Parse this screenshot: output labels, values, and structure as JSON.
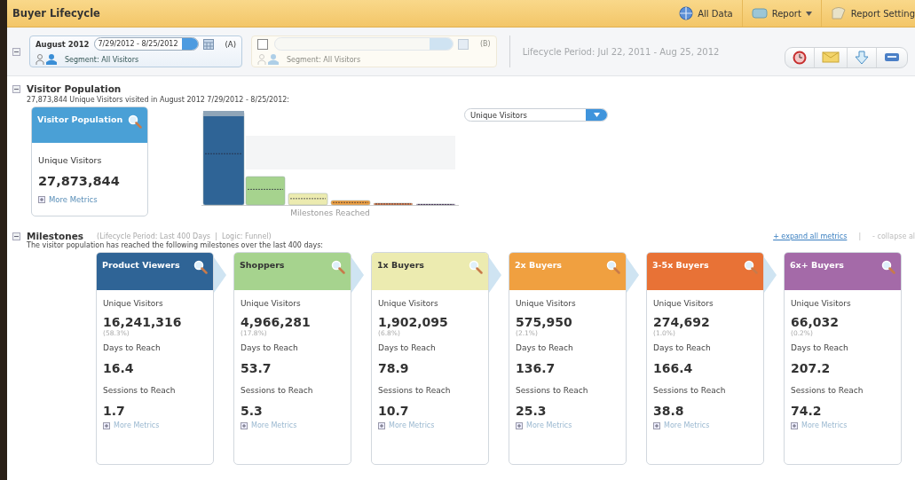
{
  "window": {
    "title": "Buyer Lifecycle"
  },
  "header_actions": [
    {
      "kind": "globe",
      "label": "All Data",
      "has_menu": false
    },
    {
      "kind": "report",
      "label": "Report",
      "has_menu": true
    },
    {
      "kind": "settings",
      "label": "Report Setting",
      "has_menu": false
    }
  ],
  "segment_a": {
    "period": "August 2012",
    "range": "7/29/2012 - 8/25/2012",
    "tag": "(A)",
    "segment": "Segment: All Visitors"
  },
  "segment_b": {
    "checked": false,
    "tag": "(B)",
    "segment": "Segment: All Visitors"
  },
  "lifecycle_period": "Lifecycle Period: Jul 22, 2011 - Aug 25, 2012",
  "action_buttons": [
    {
      "kind": "clock"
    },
    {
      "kind": "mail"
    },
    {
      "kind": "download"
    },
    {
      "kind": "print"
    }
  ],
  "visitor_population": {
    "title": "Visitor Population",
    "summary": "27,873,844 Unique Visitors visited in August 2012 7/29/2012 - 8/25/2012:",
    "card": {
      "title": "Visitor Population",
      "metric": "Unique Visitors",
      "value": "27,873,844",
      "more": "More Metrics"
    },
    "chart_label": "Milestones Reached",
    "dropdown": "Unique Visitors"
  },
  "milestones": {
    "title": "Milestones",
    "note": "(Lifecycle Period: Last 400 Days  |  Logic: Funnel)",
    "summary": "The visitor population has reached the following milestones over the last 400 days:",
    "expand": "+ expand all metrics",
    "separator": "|",
    "collapse": "- collapse al",
    "cards": [
      {
        "title": "Product Viewers",
        "color": "#2f6496",
        "uv_label": "Unique Visitors",
        "uv": "16,241,316",
        "share": "(58.3%)",
        "days_label": "Days to Reach",
        "days": "16.4",
        "sessions_label": "Sessions to Reach",
        "sessions": "1.7",
        "more": "More Metrics"
      },
      {
        "title": "Shoppers",
        "color": "#a6d38e",
        "uv_label": "Unique Visitors",
        "uv": "4,966,281",
        "share": "(17.8%)",
        "days_label": "Days to Reach",
        "days": "53.7",
        "sessions_label": "Sessions to Reach",
        "sessions": "5.3",
        "more": "More Metrics"
      },
      {
        "title": "1x Buyers",
        "color": "#ecebb0",
        "uv_label": "Unique Visitors",
        "uv": "1,902,095",
        "share": "(6.8%)",
        "days_label": "Days to Reach",
        "days": "78.9",
        "sessions_label": "Sessions to Reach",
        "sessions": "10.7",
        "more": "More Metrics"
      },
      {
        "title": "2x Buyers",
        "color": "#f0a040",
        "uv_label": "Unique Visitors",
        "uv": "575,950",
        "share": "(2.1%)",
        "days_label": "Days to Reach",
        "days": "136.7",
        "sessions_label": "Sessions to Reach",
        "sessions": "25.3",
        "more": "More Metrics"
      },
      {
        "title": "3-5x Buyers",
        "color": "#e87236",
        "uv_label": "Unique Visitors",
        "uv": "274,692",
        "share": "(1.0%)",
        "days_label": "Days to Reach",
        "days": "166.4",
        "sessions_label": "Sessions to Reach",
        "sessions": "38.8",
        "more": "More Metrics"
      },
      {
        "title": "6x+ Buyers",
        "color": "#a46aa8",
        "uv_label": "Unique Visitors",
        "uv": "66,032",
        "share": "(0.2%)",
        "days_label": "Days to Reach",
        "days": "207.2",
        "sessions_label": "Sessions to Reach",
        "sessions": "74.2",
        "more": "More Metrics"
      }
    ]
  }
}
